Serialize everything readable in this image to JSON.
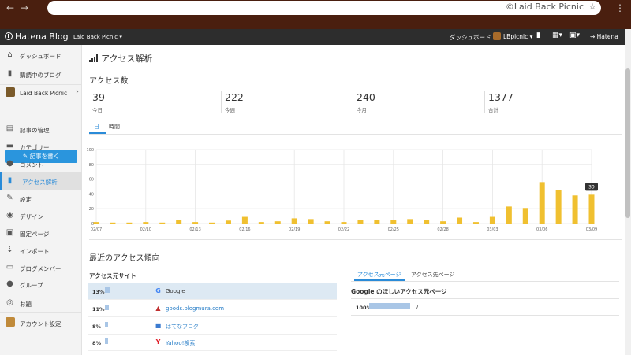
{
  "browser": {
    "url_text": "©Laid Back Picnic",
    "back": "←",
    "forward": "→",
    "star": "☆",
    "menu": "⋮"
  },
  "hatena_bar": {
    "logo": "Hatena Blog",
    "blog_selector": "Laid Back Picnic ▾",
    "dashboard": "ダッシュボード",
    "user": "LBpicnic ▾",
    "hatena": "Hatena"
  },
  "sidebar": {
    "items": [
      {
        "label": "ダッシュボード",
        "icon": "home-icon"
      },
      {
        "label": "購読中のブログ",
        "icon": "bookmark-icon"
      },
      {
        "label": "Laid Back Picnic",
        "icon": "blog-thumbnail"
      },
      {
        "label": "記事の管理",
        "icon": "document-icon"
      },
      {
        "label": "カテゴリー",
        "icon": "folder-icon"
      },
      {
        "label": "コメント",
        "icon": "comment-icon"
      },
      {
        "label": "アクセス解析",
        "icon": "bar-chart-icon"
      },
      {
        "label": "設定",
        "icon": "wrench-icon"
      },
      {
        "label": "デザイン",
        "icon": "palette-icon"
      },
      {
        "label": "固定ページ",
        "icon": "pages-icon"
      },
      {
        "label": "インポート",
        "icon": "import-icon"
      },
      {
        "label": "ブログメンバー",
        "icon": "members-icon"
      },
      {
        "label": "グループ",
        "icon": "group-icon"
      },
      {
        "label": "お題",
        "icon": "theme-icon"
      },
      {
        "label": "アカウント設定",
        "icon": "account-icon"
      }
    ],
    "write_button": "記事を書く"
  },
  "main": {
    "title": "アクセス解析",
    "access_count_title": "アクセス数",
    "stats": [
      {
        "value": "39",
        "label": "今日"
      },
      {
        "value": "222",
        "label": "今週"
      },
      {
        "value": "240",
        "label": "今月"
      },
      {
        "value": "1377",
        "label": "合計"
      }
    ],
    "tabs": [
      "日",
      "時間"
    ],
    "trend_title": "最近のアクセス傾向",
    "source_sites_title": "アクセス元サイト",
    "source_sites": [
      {
        "pct": "13%",
        "share": 0.13,
        "name": "Google",
        "icon": "google-icon",
        "link": false
      },
      {
        "pct": "11%",
        "share": 0.11,
        "name": "goods.blogmura.com",
        "icon": "blogmura-icon",
        "link": true
      },
      {
        "pct": "8%",
        "share": 0.08,
        "name": "はてなブログ",
        "icon": "hatena-blog-icon",
        "link": true
      },
      {
        "pct": "8%",
        "share": 0.08,
        "name": "Yahoo!検索",
        "icon": "yahoo-icon",
        "link": true
      }
    ],
    "right_tabs": [
      "アクセス元ページ",
      "アクセス先ページ"
    ],
    "google_pages_title": "Google のほしいアクセス元ページ",
    "google_pages": [
      {
        "pct": "100%",
        "share": 1.0,
        "path": "/"
      }
    ]
  },
  "chart_data": {
    "type": "bar",
    "categories": [
      "02/07",
      "02/08",
      "02/09",
      "02/10",
      "02/11",
      "02/12",
      "02/13",
      "02/14",
      "02/15",
      "02/16",
      "02/17",
      "02/18",
      "02/19",
      "02/20",
      "02/21",
      "02/22",
      "02/23",
      "02/24",
      "02/25",
      "02/26",
      "02/27",
      "02/28",
      "03/01",
      "03/02",
      "03/03",
      "03/04",
      "03/05",
      "03/06",
      "03/07",
      "03/08",
      "03/09"
    ],
    "x_tick_labels": [
      "02/07",
      "",
      "",
      "02/10",
      "",
      "",
      "02/13",
      "",
      "",
      "02/16",
      "",
      "",
      "02/19",
      "",
      "",
      "02/22",
      "",
      "",
      "02/25",
      "",
      "",
      "02/28",
      "",
      "",
      "03/03",
      "",
      "",
      "03/06",
      "",
      "",
      "03/09"
    ],
    "values": [
      2,
      1,
      1,
      2,
      0,
      5,
      2,
      0,
      4,
      9,
      2,
      3,
      7,
      6,
      3,
      2,
      5,
      5,
      5,
      6,
      5,
      3,
      8,
      2,
      9,
      23,
      21,
      56,
      45,
      38,
      39
    ],
    "ylim": [
      0,
      100
    ],
    "yticks": [
      0,
      20,
      40,
      60,
      80,
      100
    ],
    "bar_color": "#f0c030",
    "tooltip": {
      "category": "03/09",
      "value": "39"
    }
  }
}
